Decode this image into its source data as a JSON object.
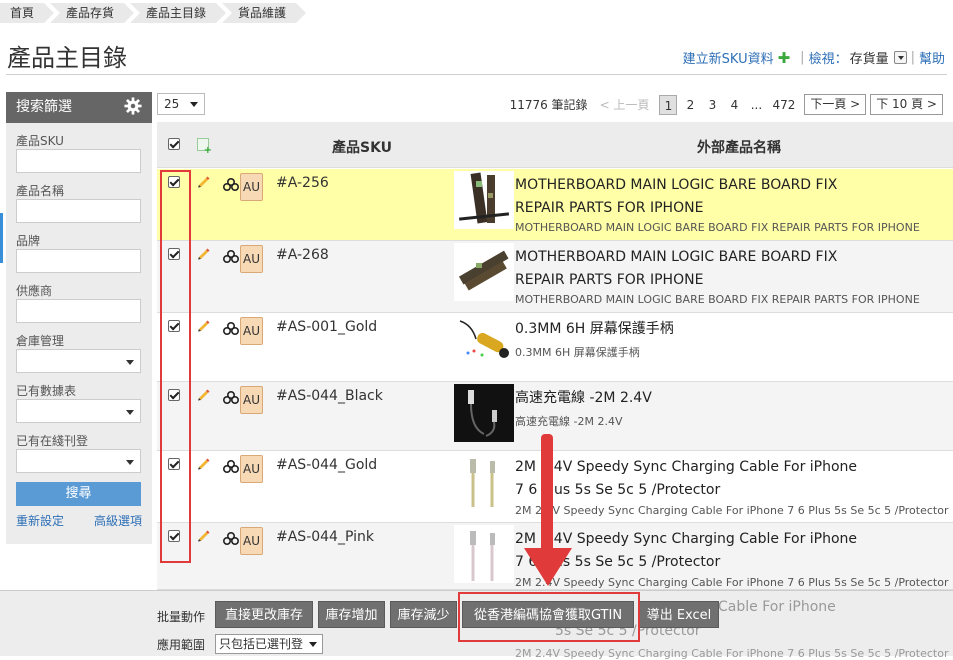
{
  "breadcrumb": [
    "首頁",
    "產品存貨",
    "產品主目錄",
    "貨品維護"
  ],
  "page_title": "產品主目錄",
  "top_actions": {
    "new_sku": "建立新SKU資料",
    "view_label": "檢視：",
    "view_value": "存貨量",
    "help": "幫助"
  },
  "sidebar": {
    "title": "搜索篩選",
    "filters": [
      {
        "label": "產品SKU",
        "type": "text"
      },
      {
        "label": "產品名稱",
        "type": "text"
      },
      {
        "label": "品牌",
        "type": "text"
      },
      {
        "label": "供應商",
        "type": "text"
      },
      {
        "label": "倉庫管理",
        "type": "select"
      },
      {
        "label": "已有數據表",
        "type": "select"
      },
      {
        "label": "已有在綫刊登",
        "type": "select"
      }
    ],
    "search_button": "搜尋",
    "reset_link": "重新設定",
    "advanced_link": "高級選項"
  },
  "pagination": {
    "page_size": "25",
    "record_count": "11776 筆記錄",
    "prev": "< 上一頁",
    "pages": [
      "1",
      "2",
      "3",
      "4",
      "...",
      "472"
    ],
    "active_page": "1",
    "next": "下一頁 >",
    "next10": "下 10 頁 >"
  },
  "table": {
    "col_sku": "產品SKU",
    "col_name": "外部產品名稱",
    "rows": [
      {
        "sku": "#A-256",
        "badge": "AU",
        "name_line1": "MOTHERBOARD MAIN LOGIC BARE BOARD FIX",
        "name_line2": "REPAIR PARTS FOR IPHONE",
        "sub": "MOTHERBOARD MAIN LOGIC BARE BOARD FIX REPAIR PARTS FOR IPHONE",
        "checked": true
      },
      {
        "sku": "#A-268",
        "badge": "AU",
        "name_line1": "MOTHERBOARD MAIN LOGIC BARE BOARD FIX",
        "name_line2": "REPAIR PARTS FOR IPHONE",
        "sub": "MOTHERBOARD MAIN LOGIC BARE BOARD FIX REPAIR PARTS FOR IPHONE",
        "checked": true
      },
      {
        "sku": "#AS-001_Gold",
        "badge": "AU",
        "name_line1": "0.3MM 6H 屏幕保護手柄",
        "name_line2": "",
        "sub": "0.3MM 6H 屏幕保護手柄",
        "checked": true
      },
      {
        "sku": "#AS-044_Black",
        "badge": "AU",
        "name_line1": "高速充電線 -2M 2.4V",
        "name_line2": "",
        "sub": "高速充電線 -2M 2.4V",
        "checked": true
      },
      {
        "sku": "#AS-044_Gold",
        "badge": "AU",
        "name_line1": "2M 2.4V Speedy Sync Charging Cable For iPhone",
        "name_line2": "7 6 Plus 5s Se 5c 5 /Protector",
        "sub": "2M 2.4V Speedy Sync Charging Cable For iPhone 7 6 Plus 5s Se 5c 5 /Protector",
        "checked": true
      },
      {
        "sku": "#AS-044_Pink",
        "badge": "AU",
        "name_line1": "2M 2.4V Speedy Sync Charging Cable For iPhone",
        "name_line2": "7 6 Plus 5s Se 5c 5 /Protector",
        "sub": "2M 2.4V Speedy Sync Charging Cable For iPhone 7 6 Plus 5s Se 5c 5 /Protector",
        "checked": true
      }
    ],
    "partial_row": {
      "line1": "Cable For iPhone",
      "line2": "5s Se 5c 5 /Protector",
      "sub": "2M 2.4V Speedy Sync Charging Cable For iPhone 7 6 Plus 5s Se 5c 5 /Protector"
    }
  },
  "bulk": {
    "label": "批量動作",
    "buttons": [
      "直接更改庫存",
      "庫存增加",
      "庫存減少",
      "從香港編碼協會獲取GTIN",
      "導出 Excel"
    ],
    "scope_label": "應用範圍",
    "scope_value": "只包括已選刊登"
  },
  "colors": {
    "highlight_row": "#ffffa8",
    "annotation_red": "#e03a3a",
    "link_blue": "#2d6fb7",
    "search_button": "#5b9bd5"
  }
}
